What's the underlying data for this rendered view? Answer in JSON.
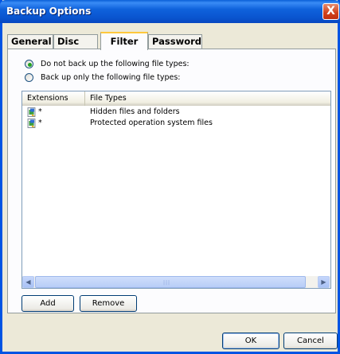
{
  "window": {
    "title": "Backup Options",
    "close_glyph": "X"
  },
  "tabs": [
    {
      "label": "General",
      "active": false
    },
    {
      "label": "Disc",
      "active": false
    },
    {
      "label": "Filter",
      "active": true
    },
    {
      "label": "Password",
      "active": false
    }
  ],
  "filter": {
    "options": [
      {
        "label": "Do not back up the following file types:",
        "selected": true
      },
      {
        "label": "Back up only the following file types:",
        "selected": false
      }
    ],
    "columns": [
      "Extensions",
      "File Types"
    ],
    "rows": [
      {
        "extension": "*",
        "file_type": "Hidden files and folders",
        "icon": "filter-rule-icon"
      },
      {
        "extension": "*",
        "file_type": "Protected operation system files",
        "icon": "filter-rule-icon"
      }
    ],
    "add_label": "Add",
    "remove_label": "Remove"
  },
  "footer": {
    "ok_label": "OK",
    "cancel_label": "Cancel"
  },
  "colors": {
    "title_bar": "#0a55d0",
    "dialog_bg": "#ece9d8",
    "active_tab_accent": "#ffc83c",
    "radio_dot": "#21a121"
  }
}
